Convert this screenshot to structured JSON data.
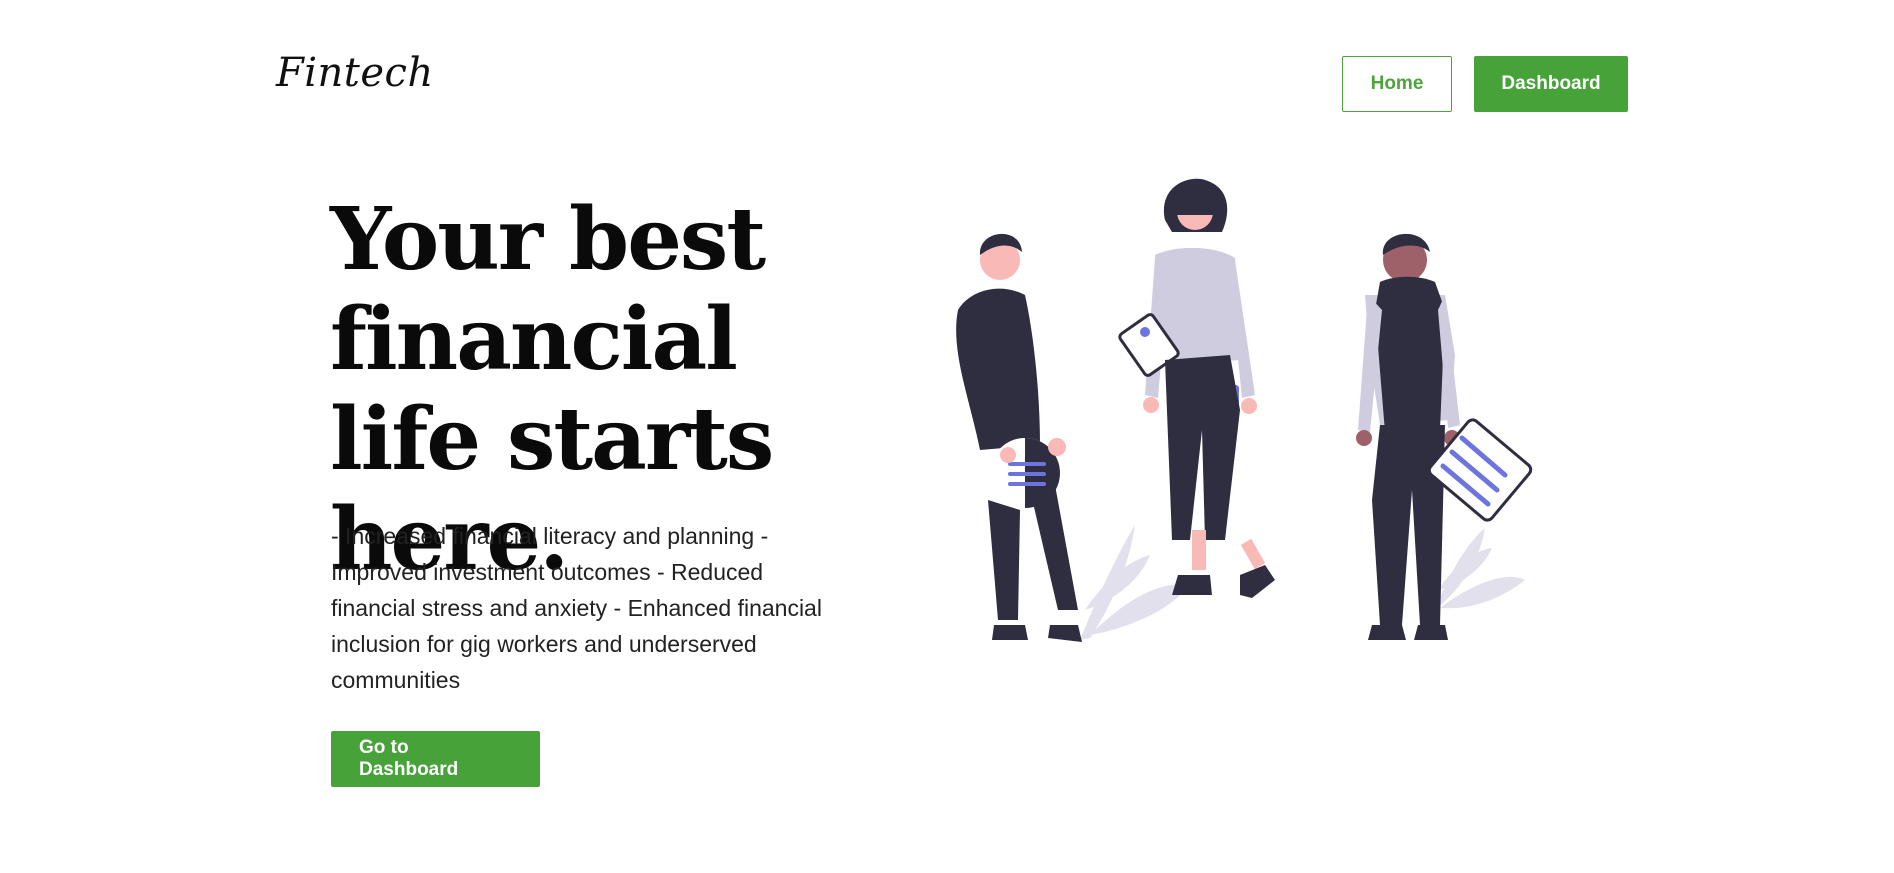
{
  "header": {
    "brand": "Fintech",
    "nav": {
      "home_label": "Home",
      "dashboard_label": "Dashboard"
    }
  },
  "hero": {
    "title": "Your best financial life starts here.",
    "description": "- Increased financial literacy and planning - Improved investment outcomes - Reduced financial stress and anxiety - Enhanced financial inclusion for gig workers and underserved communities",
    "cta_label": "Go to Dashboard"
  },
  "colors": {
    "accent": "#47a23a",
    "figure_dark": "#2f2e41",
    "figure_light": "#cfcce0",
    "skin_light": "#f8b9b7",
    "skin_dark": "#9e616a",
    "highlight": "#6c74e0"
  },
  "illustration": {
    "icon": "people-illustration"
  }
}
